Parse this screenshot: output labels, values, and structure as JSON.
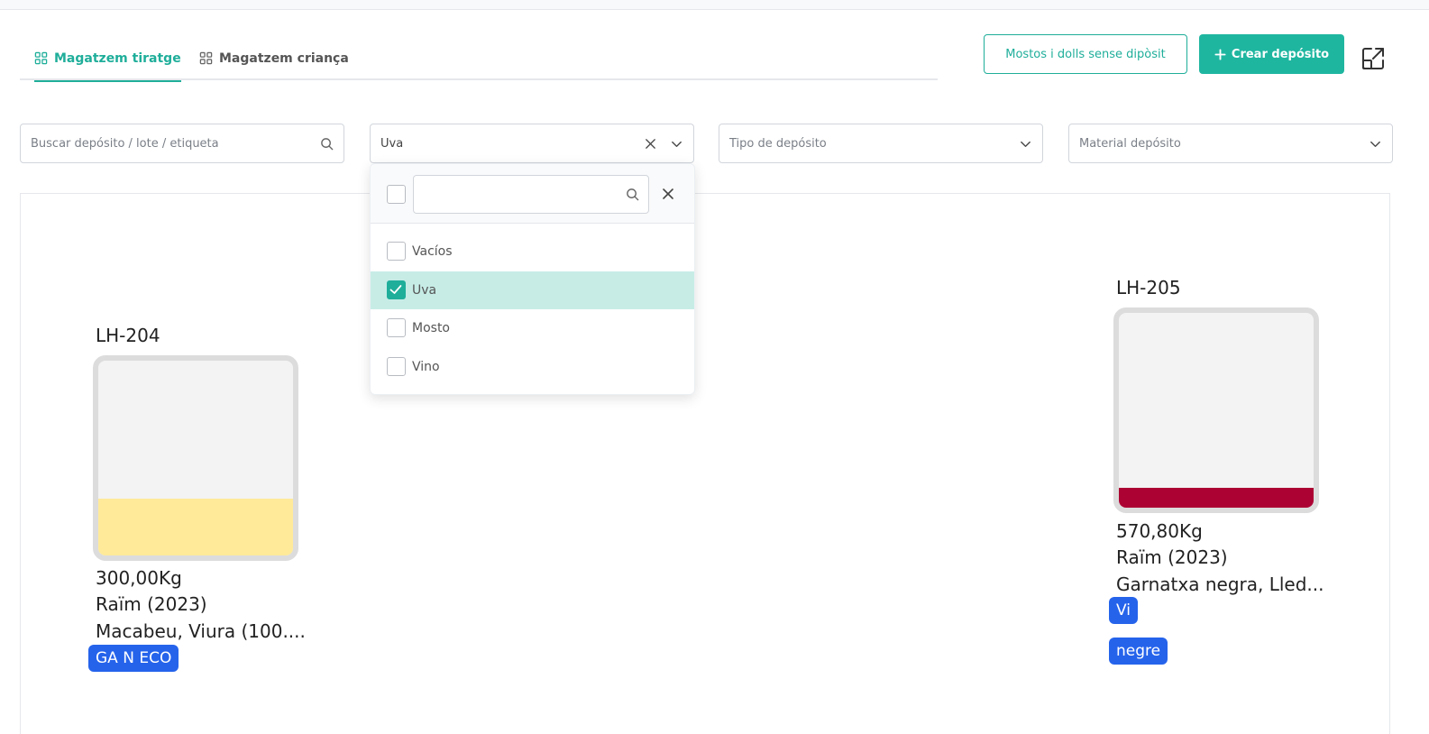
{
  "tabs": [
    {
      "label": "Magatzem tiratge",
      "active": true
    },
    {
      "label": "Magatzem criança",
      "active": false
    }
  ],
  "actions": {
    "outline_label": "Mostos i dolls sense dipòsit",
    "primary_label": "Crear depósito",
    "primary_icon": "plus-icon",
    "expand_icon": "expand-icon"
  },
  "filters": {
    "search_placeholder": "Buscar depósito / lote / etiqueta",
    "type_value": "Uva",
    "tank_type_placeholder": "Tipo de depósito",
    "material_placeholder": "Material depósito"
  },
  "dropdown": {
    "search_value": "",
    "options": [
      {
        "label": "Vacíos",
        "checked": false
      },
      {
        "label": "Uva",
        "checked": true
      },
      {
        "label": "Mosto",
        "checked": false
      },
      {
        "label": "Vino",
        "checked": false
      }
    ]
  },
  "tanks": [
    {
      "name": "LH-204",
      "fill_fraction": 0.29,
      "fill_color": "#ffea9a",
      "weight": "300,00Kg",
      "product": "Raïm (2023)",
      "varieties": "Macabeu, Viura (100....",
      "tags": [
        "GA N ECO"
      ]
    },
    {
      "name": "LH-205",
      "fill_fraction": 0.1,
      "fill_color": "#ac0233",
      "weight": "570,80Kg",
      "product": "Raïm (2023)",
      "varieties": "Garnatxa negra, Lled...",
      "tags": [
        "Vi",
        "negre"
      ]
    }
  ],
  "colors": {
    "accent": "#1fae9a",
    "tag_blue": "#2563eb"
  }
}
